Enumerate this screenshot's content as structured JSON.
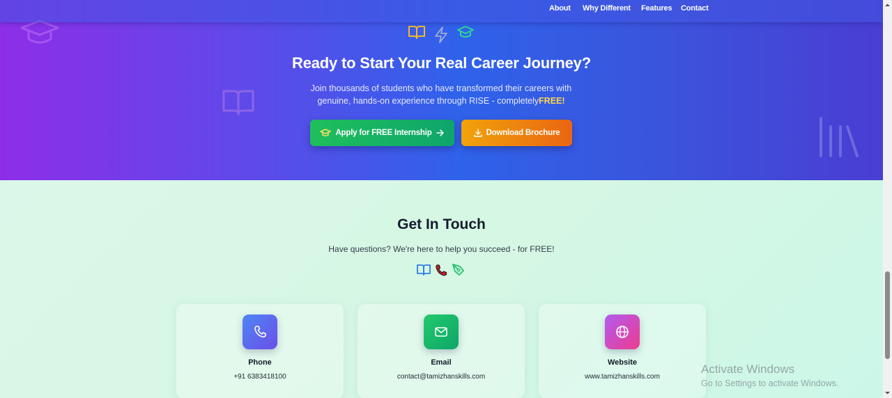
{
  "nav": {
    "links": [
      {
        "label": "About"
      },
      {
        "label": "Why Different"
      },
      {
        "label": "Features"
      },
      {
        "label": "Contact"
      }
    ]
  },
  "cta": {
    "title": "Ready to Start Your Real Career Journey?",
    "text_line1": "Join thousands of students who have transformed their careers with",
    "text_line2": "genuine, hands-on experience through RISE - completely",
    "text_highlight": "FREE!",
    "apply_button": "Apply for FREE Internship",
    "brochure_button": "Download Brochure",
    "icons": [
      "book-icon",
      "lightning-icon",
      "graduation-cap-icon"
    ]
  },
  "contact": {
    "title": "Get In Touch",
    "subtitle": "Have questions? We're here to help you succeed - for FREE!",
    "icons": [
      "book-icon",
      "phone-icon",
      "pen-icon"
    ],
    "cards": [
      {
        "label": "Phone",
        "value": "+91 6383418100",
        "icon": "phone-icon",
        "color": "#5b6cf0"
      },
      {
        "label": "Email",
        "value": "contact@tamizhanskills.com",
        "icon": "mail-icon",
        "color": "#18b463"
      },
      {
        "label": "Website",
        "value": "www.tamizhanskills.com",
        "icon": "globe-icon",
        "color": "#d83fb0"
      }
    ]
  },
  "watermark": {
    "title": "Activate Windows",
    "subtitle": "Go to Settings to activate Windows."
  },
  "colors": {
    "accent_yellow": "#ffd84a",
    "apply_green": "#1fbf5c",
    "brochure_orange": "#ea6512"
  }
}
